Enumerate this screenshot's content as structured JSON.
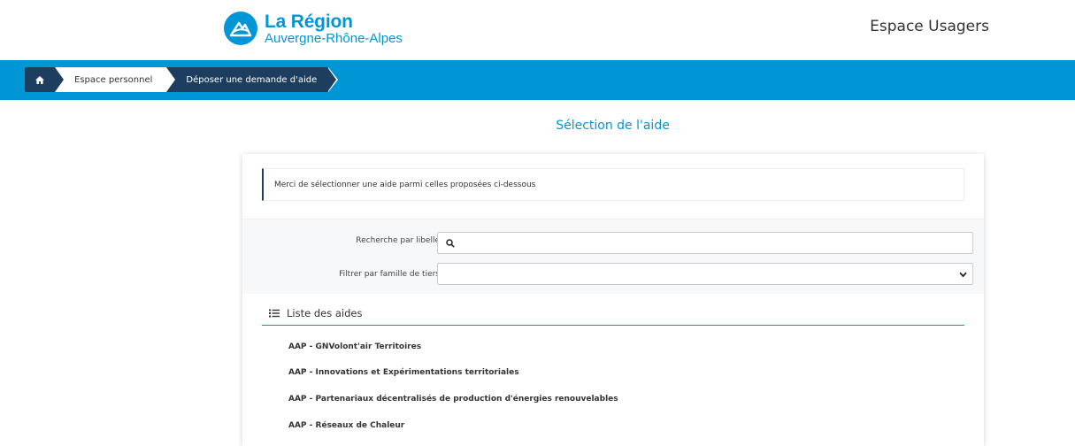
{
  "header": {
    "logo_title": "La Région",
    "logo_subtitle": "Auvergne-Rhône-Alpes",
    "title": "Espace Usagers",
    "brand_color": "#0096d6",
    "dark_color": "#1d3e5e"
  },
  "breadcrumb": {
    "home_icon": "home-icon",
    "items": [
      "Espace personnel",
      "Déposer une demande d'aide"
    ]
  },
  "main": {
    "section_title": "Sélection de l'aide",
    "info_text": "Merci de sélectionner une aide parmi celles proposées ci-dessous",
    "search": {
      "label": "Recherche par libellé",
      "value": ""
    },
    "filter": {
      "label": "Filtrer par famille de tiers",
      "selected": ""
    },
    "list": {
      "title": "Liste des aides",
      "items": [
        "AAP - GNVolont'air Territoires",
        "AAP - Innovations et Expérimentations territoriales",
        "AAP - Partenariaux décentralisés de production d'énergies renouvelables",
        "AAP - Réseaux de Chaleur"
      ]
    }
  }
}
